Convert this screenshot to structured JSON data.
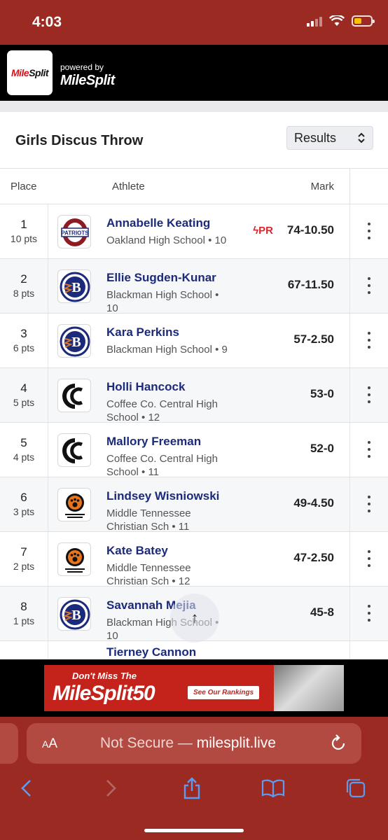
{
  "status_bar": {
    "time": "4:03"
  },
  "header": {
    "logo_text_red": "Mile",
    "logo_text_dark": "Split",
    "powered_by": "powered by",
    "brand": "MileSplit"
  },
  "event": {
    "title": "Girls Discus Throw",
    "view_select": "Results"
  },
  "table": {
    "headers": {
      "place": "Place",
      "athlete": "Athlete",
      "mark": "Mark"
    },
    "rows": [
      {
        "place": "1",
        "points": "10 pts",
        "name": "Annabelle Keating",
        "school": "Oakland High School • 10",
        "mark": "74-10.50",
        "pr": "PR",
        "logo": "oakland-patriots-logo"
      },
      {
        "place": "2",
        "points": "8 pts",
        "name": "Ellie Sugden-Kunar",
        "school": "Blackman High School • 10",
        "mark": "67-11.50",
        "logo": "blackman-b-logo"
      },
      {
        "place": "3",
        "points": "6 pts",
        "name": "Kara Perkins",
        "school": "Blackman High School • 9",
        "mark": "57-2.50",
        "logo": "blackman-b-logo"
      },
      {
        "place": "4",
        "points": "5 pts",
        "name": "Holli Hancock",
        "school": "Coffee Co. Central High School • 12",
        "mark": "53-0",
        "logo": "coffee-county-cc-logo"
      },
      {
        "place": "5",
        "points": "4 pts",
        "name": "Mallory Freeman",
        "school": "Coffee Co. Central High School • 11",
        "mark": "52-0",
        "logo": "coffee-county-cc-logo"
      },
      {
        "place": "6",
        "points": "3 pts",
        "name": "Lindsey Wisniowski",
        "school": "Middle Tennessee Christian Sch • 11",
        "mark": "49-4.50",
        "logo": "mtcs-paw-logo"
      },
      {
        "place": "7",
        "points": "2 pts",
        "name": "Kate Batey",
        "school": "Middle Tennessee Christian Sch • 12",
        "mark": "47-2.50",
        "logo": "mtcs-paw-logo"
      },
      {
        "place": "8",
        "points": "1 pts",
        "name": "Savannah Mejia",
        "school": "Blackman High School • 10",
        "mark": "45-8",
        "logo": "blackman-b-logo"
      },
      {
        "place": "",
        "points": "",
        "name": "Tierney Cannon",
        "school": "",
        "mark": "",
        "logo": "oakland-patriots-logo"
      }
    ]
  },
  "ad": {
    "line1": "Don't Miss The",
    "line2": "MileSplit50",
    "cta": "See Our Rankings"
  },
  "browser": {
    "aa": "AA",
    "url_prefix": "Not Secure —",
    "url_host": "milesplit.live"
  },
  "colors": {
    "chrome": "#9b2a22",
    "name_blue": "#1b2a7a",
    "pr_red": "#d8262c"
  }
}
